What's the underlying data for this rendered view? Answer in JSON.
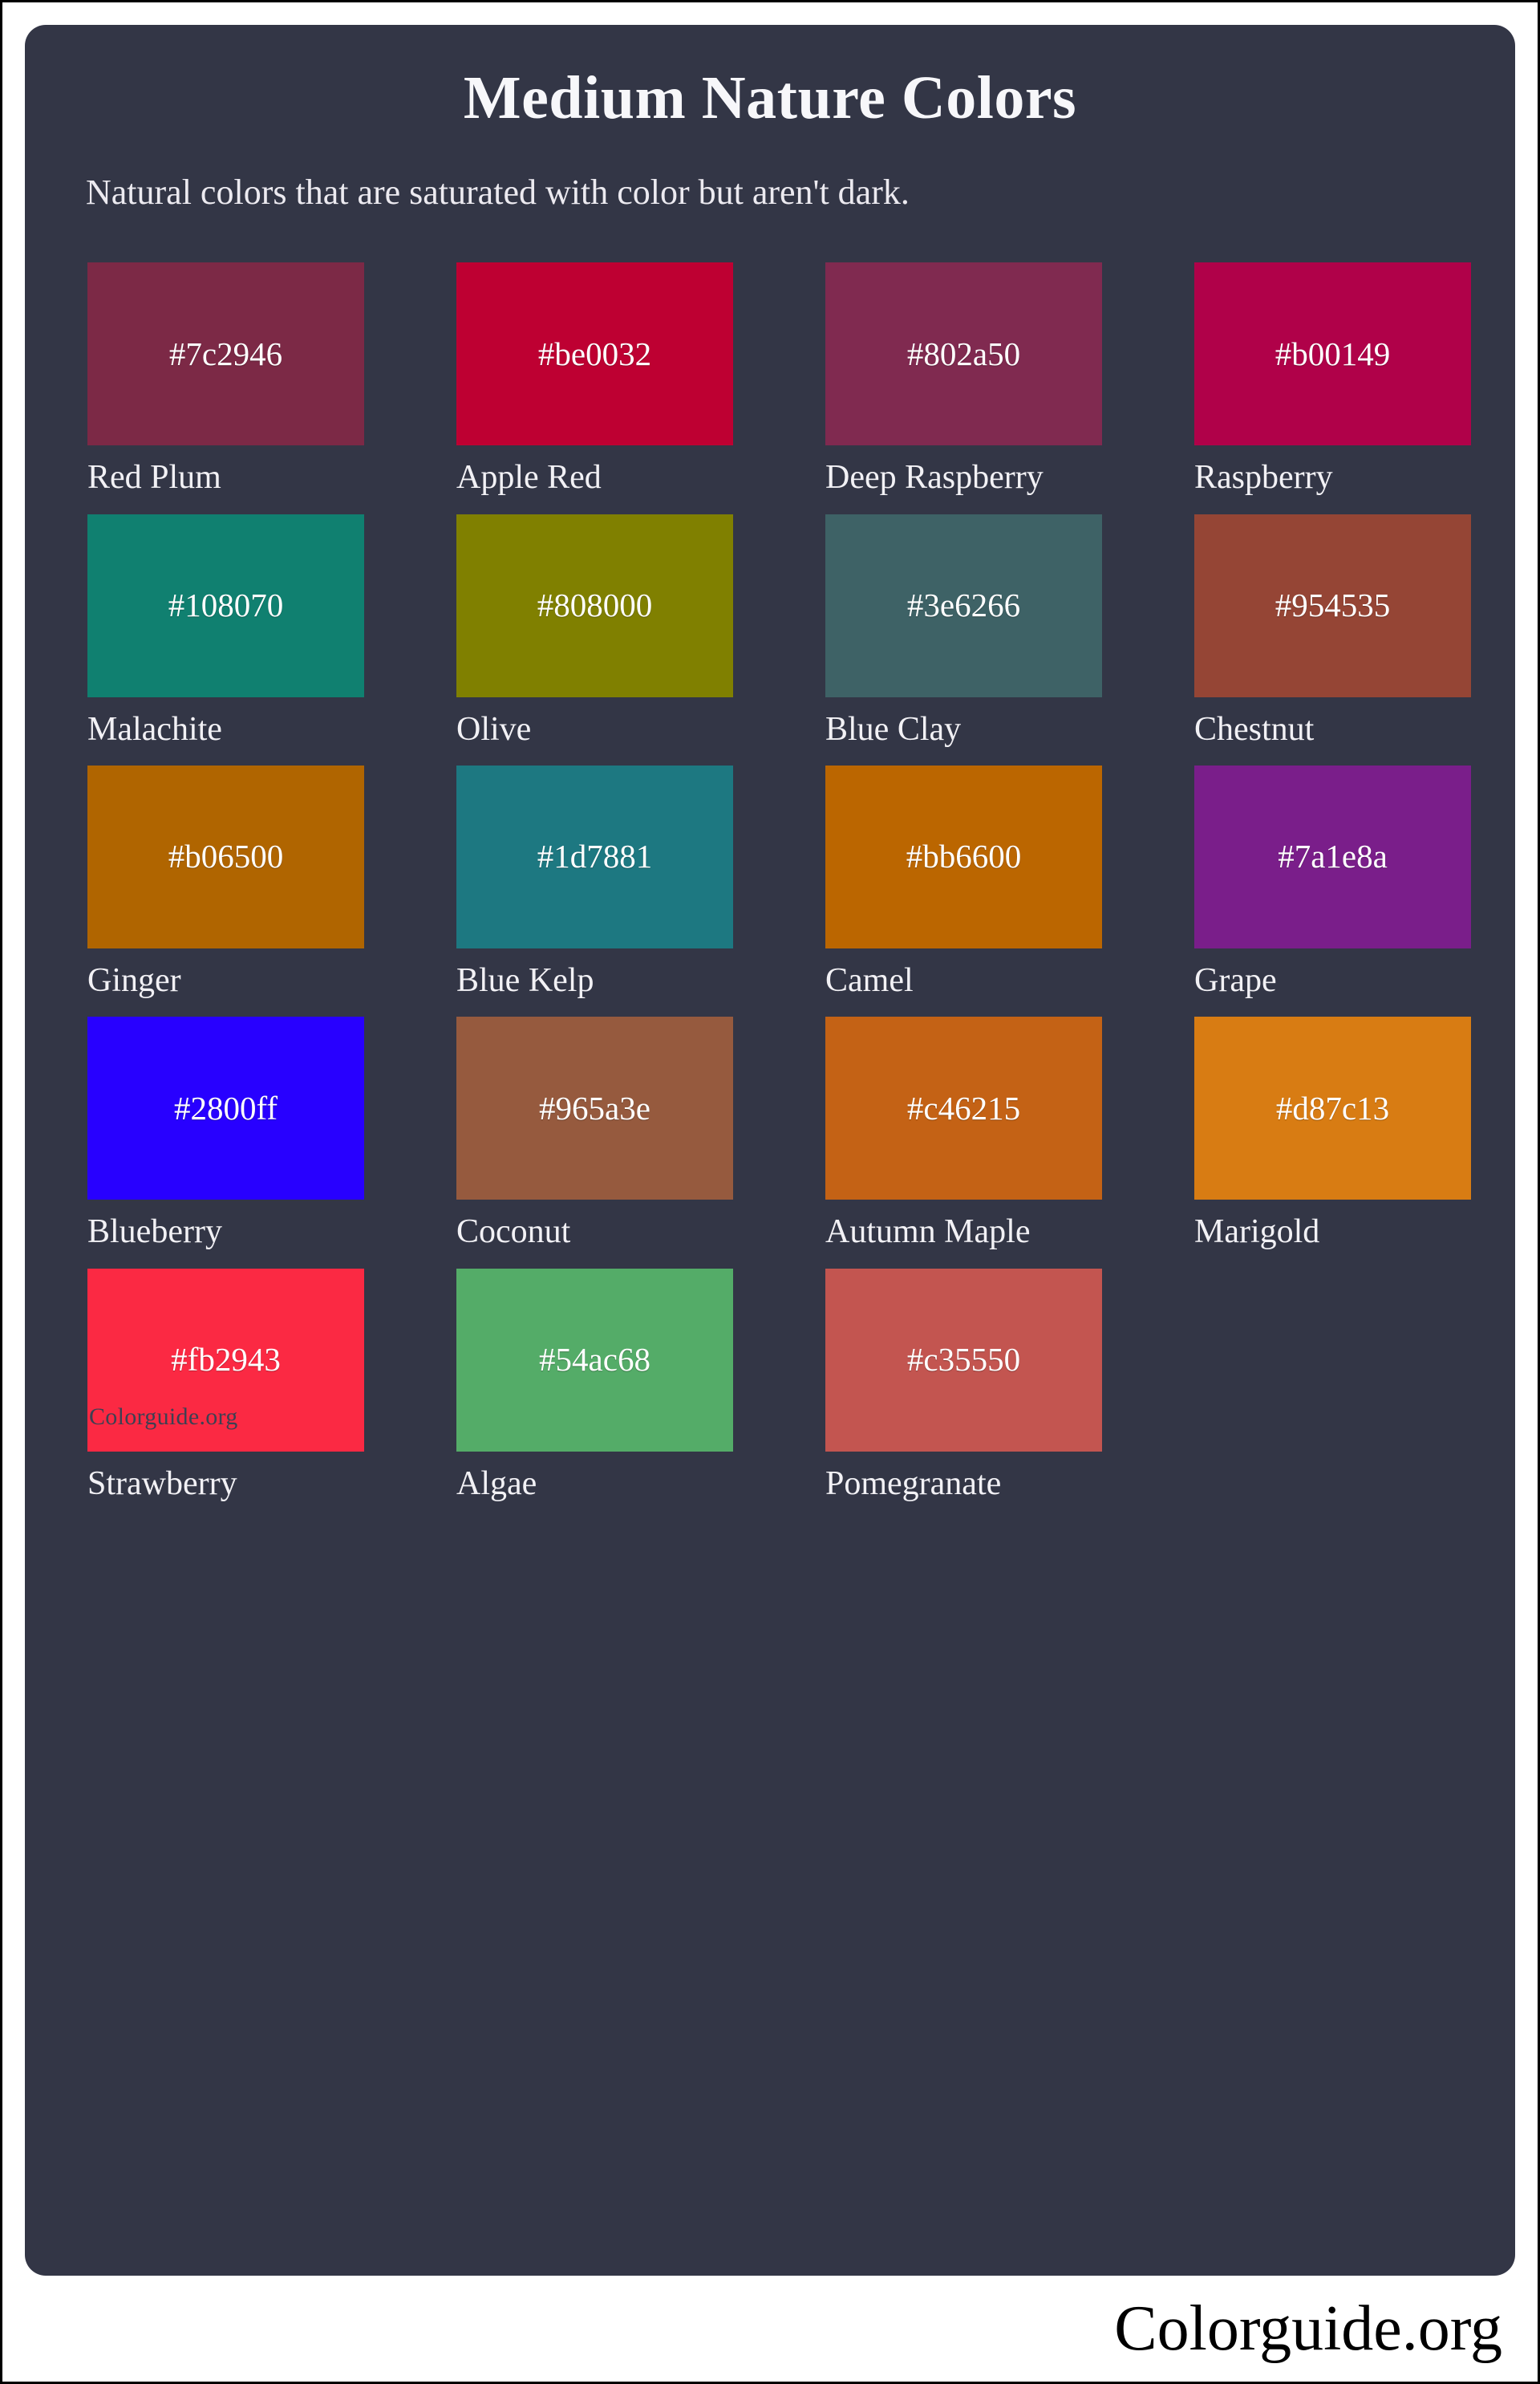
{
  "page": {
    "title": "Medium Nature Colors",
    "subtitle": "Natural colors that are saturated with color but aren't dark.",
    "background_color": "#ffffff",
    "card_background_color": "#333646",
    "title_color": "#f7f7fa",
    "watermark": "Colorguide.org"
  },
  "footer": {
    "brand": "Colorguide.org"
  },
  "swatches": [
    {
      "hex": "#7c2946",
      "name": "Red Plum"
    },
    {
      "hex": "#be0032",
      "name": "Apple Red"
    },
    {
      "hex": "#802a50",
      "name": "Deep Raspberry"
    },
    {
      "hex": "#b00149",
      "name": "Raspberry"
    },
    {
      "hex": "#108070",
      "name": "Malachite"
    },
    {
      "hex": "#808000",
      "name": "Olive"
    },
    {
      "hex": "#3e6266",
      "name": "Blue Clay"
    },
    {
      "hex": "#954535",
      "name": "Chestnut"
    },
    {
      "hex": "#b06500",
      "name": "Ginger"
    },
    {
      "hex": "#1d7881",
      "name": "Blue Kelp"
    },
    {
      "hex": "#bb6600",
      "name": "Camel"
    },
    {
      "hex": "#7a1e8a",
      "name": "Grape"
    },
    {
      "hex": "#2800ff",
      "name": "Blueberry"
    },
    {
      "hex": "#965a3e",
      "name": "Coconut"
    },
    {
      "hex": "#c46215",
      "name": "Autumn Maple"
    },
    {
      "hex": "#d87c13",
      "name": "Marigold"
    },
    {
      "hex": "#fb2943",
      "name": "Strawberry"
    },
    {
      "hex": "#54ac68",
      "name": "Algae"
    },
    {
      "hex": "#c35550",
      "name": "Pomegranate"
    }
  ]
}
